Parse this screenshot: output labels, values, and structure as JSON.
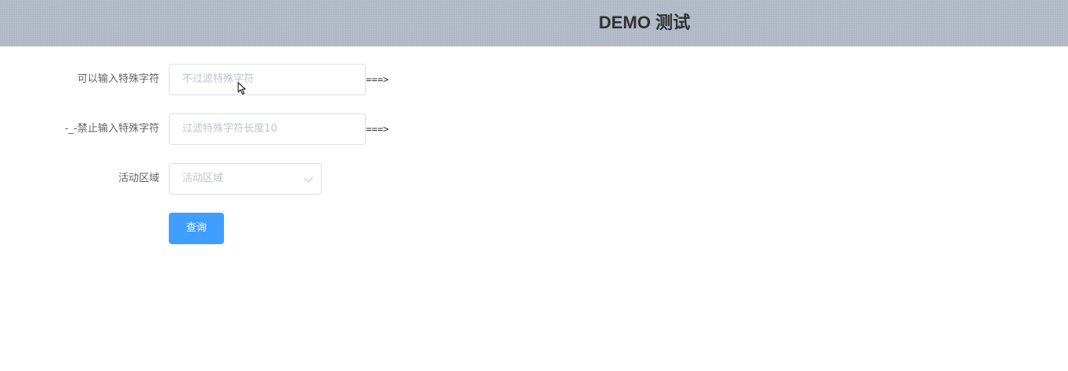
{
  "header": {
    "title": "DEMO 测试"
  },
  "form": {
    "field1": {
      "label": "可以输入特殊字符",
      "placeholder": "不过滤特殊字符",
      "suffix": "===>"
    },
    "field2": {
      "label": "-_-禁止输入特殊字符",
      "placeholder": "过滤特殊字符长度10",
      "suffix": "===>"
    },
    "region": {
      "label": "活动区域",
      "placeholder": "活动区域"
    },
    "submit_label": "查询"
  },
  "colors": {
    "header_bg": "#b0b8c6",
    "primary": "#409eff",
    "placeholder": "#c0c4cc",
    "label": "#606266",
    "border": "#dcdfe6"
  }
}
